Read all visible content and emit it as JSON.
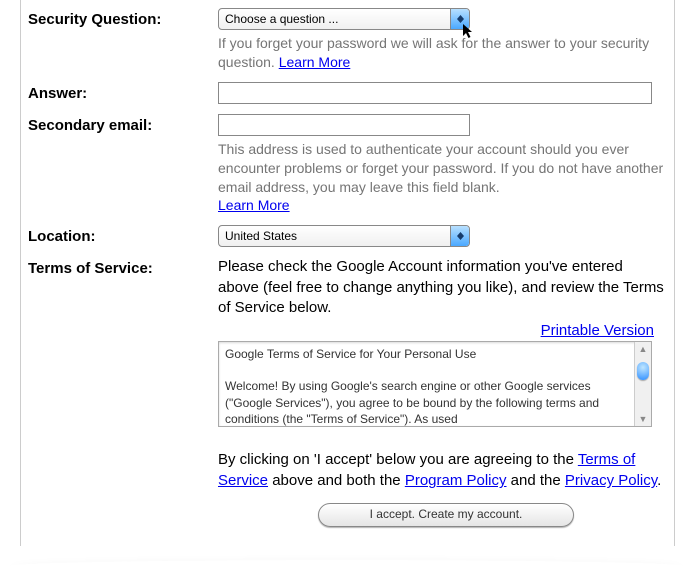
{
  "security_question": {
    "label": "Security Question:",
    "dropdown_value": "Choose a question ...",
    "helper": "If you forget your password we will ask for the answer to your security question. ",
    "learn_more": "Learn More"
  },
  "answer": {
    "label": "Answer:",
    "value": ""
  },
  "secondary_email": {
    "label": "Secondary email:",
    "value": "",
    "helper": "This address is used to authenticate your account should you ever encounter problems or forget your password. If you do not have another email address, you may leave this field blank.",
    "learn_more": "Learn More"
  },
  "location": {
    "label": "Location:",
    "dropdown_value": "United States"
  },
  "tos": {
    "label": "Terms of Service:",
    "intro": "Please check the Google Account information you've entered above (feel free to change anything you like), and review the Terms of Service below.",
    "printable_link": "Printable Version",
    "box_text": "Google Terms of Service for Your Personal Use\n\nWelcome! By using Google's search engine or other Google services (\"Google Services\"), you agree to be bound by the following terms and conditions (the \"Terms of Service\"). As used"
  },
  "agreement": {
    "pre": "By clicking on 'I accept' below you are agreeing to the ",
    "terms_link": "Terms of Service",
    "mid1": " above and both the ",
    "program_link": "Program Policy",
    "mid2": " and the ",
    "privacy_link": "Privacy Policy",
    "post": "."
  },
  "accept_button_label": "I accept. Create my account."
}
